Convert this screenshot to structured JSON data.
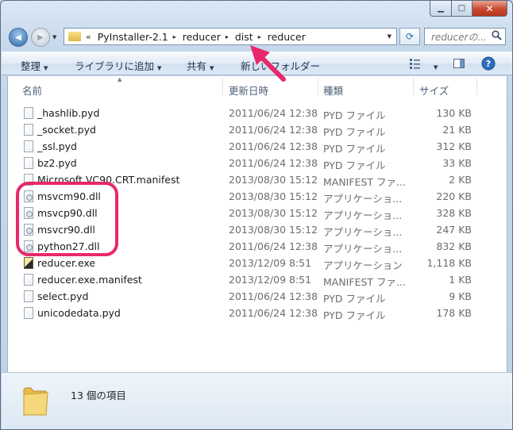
{
  "window": {
    "buttons": {
      "minimize": "▁",
      "maximize": "□",
      "close": "✕"
    }
  },
  "nav": {
    "back_icon": "◀",
    "forward_icon": "▶",
    "chevron": "«",
    "breadcrumbs": [
      "PyInstaller-2.1",
      "reducer",
      "dist",
      "reducer"
    ],
    "separator": "▸",
    "refresh_icon": "⟳",
    "search_placeholder": "reducerの...",
    "search_icon": "⚲"
  },
  "toolbar": {
    "organize": "整理",
    "add_to_library": "ライブラリに追加",
    "share": "共有",
    "new_folder": "新しいフォルダー"
  },
  "columns": {
    "name": "名前",
    "date": "更新日時",
    "type": "種類",
    "size": "サイズ"
  },
  "files": [
    {
      "name": "_hashlib.pyd",
      "date": "2011/06/24 12:38",
      "type": "PYD ファイル",
      "size": "130 KB",
      "icon": "file-icon"
    },
    {
      "name": "_socket.pyd",
      "date": "2011/06/24 12:38",
      "type": "PYD ファイル",
      "size": "21 KB",
      "icon": "file-icon"
    },
    {
      "name": "_ssl.pyd",
      "date": "2011/06/24 12:38",
      "type": "PYD ファイル",
      "size": "312 KB",
      "icon": "file-icon"
    },
    {
      "name": "bz2.pyd",
      "date": "2011/06/24 12:38",
      "type": "PYD ファイル",
      "size": "33 KB",
      "icon": "file-icon"
    },
    {
      "name": "Microsoft.VC90.CRT.manifest",
      "date": "2013/08/30 15:12",
      "type": "MANIFEST ファ...",
      "size": "2 KB",
      "icon": "file-icon"
    },
    {
      "name": "msvcm90.dll",
      "date": "2013/08/30 15:12",
      "type": "アプリケーショ...",
      "size": "220 KB",
      "icon": "dll-icon"
    },
    {
      "name": "msvcp90.dll",
      "date": "2013/08/30 15:12",
      "type": "アプリケーショ...",
      "size": "328 KB",
      "icon": "dll-icon"
    },
    {
      "name": "msvcr90.dll",
      "date": "2013/08/30 15:12",
      "type": "アプリケーショ...",
      "size": "247 KB",
      "icon": "dll-icon"
    },
    {
      "name": "python27.dll",
      "date": "2011/06/24 12:38",
      "type": "アプリケーショ...",
      "size": "832 KB",
      "icon": "dll-icon"
    },
    {
      "name": "reducer.exe",
      "date": "2013/12/09 8:51",
      "type": "アプリケーション",
      "size": "1,118 KB",
      "icon": "exe-icon"
    },
    {
      "name": "reducer.exe.manifest",
      "date": "2013/12/09 8:51",
      "type": "MANIFEST ファ...",
      "size": "1 KB",
      "icon": "file-icon"
    },
    {
      "name": "select.pyd",
      "date": "2011/06/24 12:38",
      "type": "PYD ファイル",
      "size": "9 KB",
      "icon": "file-icon"
    },
    {
      "name": "unicodedata.pyd",
      "date": "2011/06/24 12:38",
      "type": "PYD ファイル",
      "size": "178 KB",
      "icon": "file-icon"
    }
  ],
  "details": {
    "item_count": "13 個の項目"
  },
  "colors": {
    "annotation": "#e8286b",
    "window_frame": "#c6d8ec",
    "close_button": "#c9482f"
  }
}
